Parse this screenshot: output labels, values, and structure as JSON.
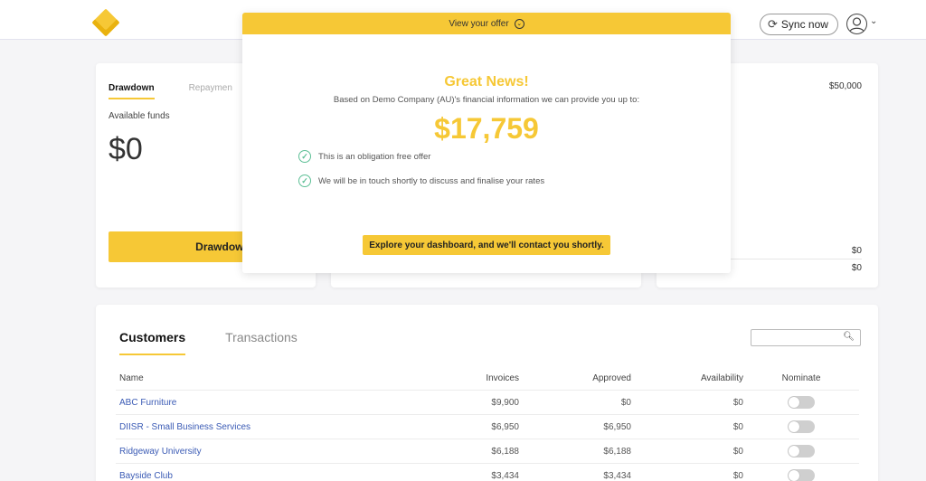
{
  "header": {
    "sync_label": "Sync now"
  },
  "drawdown_card": {
    "tabs": [
      "Drawdown",
      "Repaymen"
    ],
    "available_label": "Available funds",
    "available_value": "$0",
    "button_label": "Drawdown funds"
  },
  "right_card": {
    "top_value": "$50,000",
    "row1_value": "$0",
    "row2_value": "$0"
  },
  "modal": {
    "bar_label": "View your offer",
    "title": "Great News!",
    "subtitle": "Based on Demo Company (AU)'s financial information we can provide you up to:",
    "amount": "$17,759",
    "checks": [
      "This is an obligation free offer",
      "We will be in touch shortly to discuss and finalise your rates"
    ],
    "button_label": "Explore your dashboard, and we'll contact you shortly."
  },
  "customers": {
    "tabs": [
      "Customers",
      "Transactions"
    ],
    "search_placeholder": "",
    "columns": [
      "Name",
      "Invoices",
      "Approved",
      "Availability",
      "Nominate"
    ],
    "rows": [
      {
        "name": "ABC Furniture",
        "invoices": "$9,900",
        "approved": "$0",
        "availability": "$0"
      },
      {
        "name": "DIISR - Small Business Services",
        "invoices": "$6,950",
        "approved": "$6,950",
        "availability": "$0"
      },
      {
        "name": "Ridgeway University",
        "invoices": "$6,188",
        "approved": "$6,188",
        "availability": "$0"
      },
      {
        "name": "Bayside Club",
        "invoices": "$3,434",
        "approved": "$3,434",
        "availability": "$0"
      }
    ]
  },
  "colors": {
    "accent": "#f6c836",
    "check": "#5cbf95",
    "link": "#3b5bb5"
  }
}
